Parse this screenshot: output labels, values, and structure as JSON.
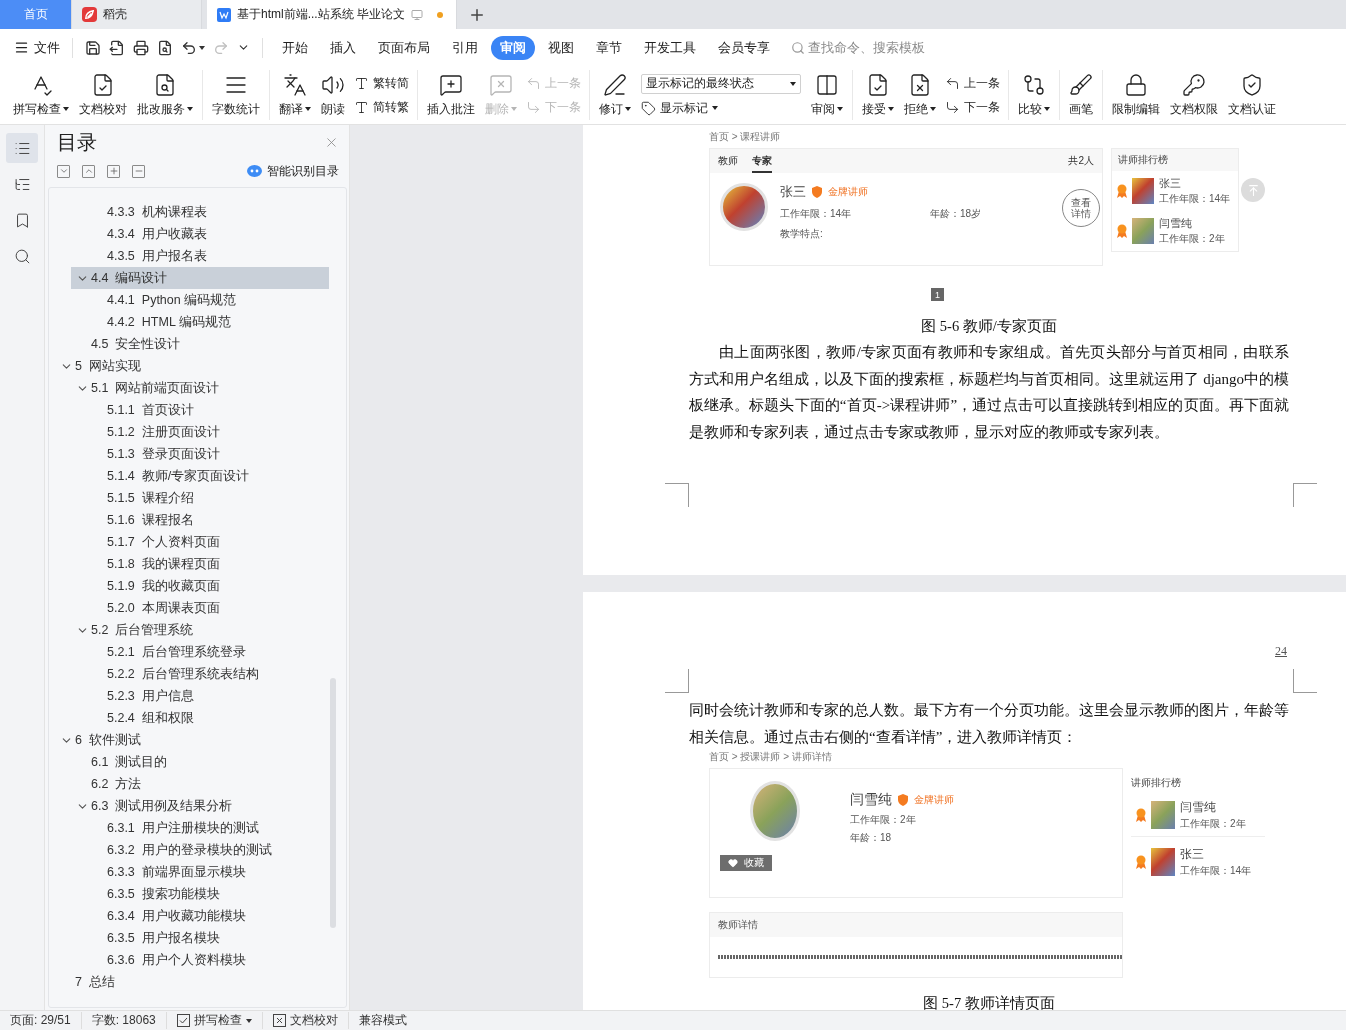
{
  "tabs": [
    {
      "label": "首页",
      "kind": "home",
      "selected": false
    },
    {
      "label": "稻壳",
      "kind": "app",
      "selected": false
    },
    {
      "label": "基于html前端...站系统 毕业论文",
      "kind": "document",
      "selected": true,
      "unsaved": true
    }
  ],
  "menu": {
    "file": "文件",
    "quick_tools": [
      {
        "disabled": false
      },
      {
        "disabled": false
      },
      {
        "disabled": false
      },
      {
        "disabled": false
      },
      {
        "disabled": false
      },
      {
        "disabled": true
      },
      {
        "disabled": false
      }
    ],
    "tabs": [
      {
        "label": "开始",
        "selected": false
      },
      {
        "label": "插入",
        "selected": false
      },
      {
        "label": "页面布局",
        "selected": false
      },
      {
        "label": "引用",
        "selected": false
      },
      {
        "label": "审阅",
        "selected": true
      },
      {
        "label": "视图",
        "selected": false
      },
      {
        "label": "章节",
        "selected": false
      },
      {
        "label": "开发工具",
        "selected": false
      },
      {
        "label": "会员专享",
        "selected": false
      }
    ],
    "search": {
      "placeholder": "查找命令、搜索模板"
    }
  },
  "ribbon": {
    "groups": [
      {
        "items": [
          {
            "kind": "large",
            "label": "拼写检查",
            "dropdown": true,
            "disabled": false
          },
          {
            "kind": "large",
            "label": "文档校对",
            "dropdown": false,
            "disabled": false
          },
          {
            "kind": "large",
            "label": "批改服务",
            "dropdown": true,
            "disabled": false
          }
        ]
      },
      {
        "items": [
          {
            "kind": "large",
            "label": "字数统计",
            "dropdown": false,
            "disabled": false
          }
        ]
      },
      {
        "items": [
          {
            "kind": "large",
            "label": "翻译",
            "dropdown": true,
            "disabled": false
          },
          {
            "kind": "large",
            "label": "朗读",
            "dropdown": false,
            "disabled": false
          },
          {
            "kind": "stack",
            "rows": [
              {
                "label": "繁转简",
                "disabled": false
              },
              {
                "label": "简转繁",
                "disabled": false
              }
            ]
          }
        ]
      },
      {
        "items": [
          {
            "kind": "large",
            "label": "插入批注",
            "dropdown": false,
            "disabled": false
          },
          {
            "kind": "large",
            "label": "删除",
            "dropdown": true,
            "disabled": true
          },
          {
            "kind": "stack",
            "rows": [
              {
                "label": "上一条",
                "disabled": true
              },
              {
                "label": "下一条",
                "disabled": true
              }
            ]
          }
        ]
      },
      {
        "items": [
          {
            "kind": "large",
            "label": "修订",
            "dropdown": true,
            "disabled": false
          },
          {
            "kind": "select",
            "value": "显示标记的最终状态",
            "option": {
              "label": "显示标记",
              "dropdown": true
            }
          },
          {
            "kind": "large",
            "label": "审阅",
            "dropdown": true,
            "disabled": false
          }
        ]
      },
      {
        "items": [
          {
            "kind": "large",
            "label": "接受",
            "dropdown": true,
            "disabled": false
          },
          {
            "kind": "large",
            "label": "拒绝",
            "dropdown": true,
            "disabled": false
          },
          {
            "kind": "stack",
            "rows": [
              {
                "label": "上一条",
                "disabled": false
              },
              {
                "label": "下一条",
                "disabled": false
              }
            ]
          }
        ]
      },
      {
        "items": [
          {
            "kind": "large",
            "label": "比较",
            "dropdown": true,
            "disabled": false
          }
        ]
      },
      {
        "items": [
          {
            "kind": "large",
            "label": "画笔",
            "dropdown": false,
            "disabled": false
          }
        ]
      },
      {
        "items": [
          {
            "kind": "large",
            "label": "限制编辑",
            "dropdown": false,
            "disabled": false
          },
          {
            "kind": "large",
            "label": "文档权限",
            "dropdown": false,
            "disabled": false
          },
          {
            "kind": "large",
            "label": "文档认证",
            "dropdown": false,
            "disabled": false
          }
        ]
      }
    ]
  },
  "rail": [
    {
      "selected": true
    },
    {
      "selected": false
    },
    {
      "selected": false
    },
    {
      "selected": false
    }
  ],
  "toc": {
    "title": "目录",
    "smart_button": "智能识别目录",
    "tree": [
      {
        "children": [
          {
            "children": [
              {
                "number": "4.3.3",
                "title": "机构课程表",
                "selected": false
              },
              {
                "number": "4.3.4",
                "title": "用户收藏表",
                "selected": false
              },
              {
                "number": "4.3.5",
                "title": "用户报名表",
                "selected": false
              }
            ]
          },
          {
            "number": "4.4",
            "title": "编码设计",
            "selected": true,
            "expanded": true,
            "children": [
              {
                "number": "4.4.1",
                "title": "Python 编码规范",
                "selected": false
              },
              {
                "number": "4.4.2",
                "title": "HTML 编码规范",
                "selected": false
              }
            ]
          },
          {
            "number": "4.5",
            "title": "安全性设计",
            "selected": false
          }
        ]
      },
      {
        "number": "5",
        "title": "网站实现",
        "selected": false,
        "expanded": true,
        "children": [
          {
            "number": "5.1",
            "title": "网站前端页面设计",
            "selected": false,
            "expanded": true,
            "children": [
              {
                "number": "5.1.1",
                "title": "首页设计",
                "selected": false
              },
              {
                "number": "5.1.2",
                "title": "注册页面设计",
                "selected": false
              },
              {
                "number": "5.1.3",
                "title": "登录页面设计",
                "selected": false
              },
              {
                "number": "5.1.4",
                "title": "教师/专家页面设计",
                "selected": false
              },
              {
                "number": "5.1.5",
                "title": "课程介绍",
                "selected": false
              },
              {
                "number": "5.1.6",
                "title": "课程报名",
                "selected": false
              },
              {
                "number": "5.1.7",
                "title": "个人资料页面",
                "selected": false
              },
              {
                "number": "5.1.8",
                "title": "我的课程页面",
                "selected": false
              },
              {
                "number": "5.1.9",
                "title": "我的收藏页面",
                "selected": false
              },
              {
                "number": "5.2.0",
                "title": "本周课表页面",
                "selected": false
              }
            ]
          },
          {
            "number": "5.2",
            "title": "后台管理系统",
            "selected": false,
            "expanded": true,
            "children": [
              {
                "number": "5.2.1",
                "title": "后台管理系统登录",
                "selected": false
              },
              {
                "number": "5.2.2",
                "title": "后台管理系统表结构",
                "selected": false
              },
              {
                "number": "5.2.3",
                "title": "用户信息",
                "selected": false
              },
              {
                "number": "5.2.4",
                "title": "组和权限",
                "selected": false
              }
            ]
          }
        ]
      },
      {
        "number": "6",
        "title": "软件测试",
        "selected": false,
        "expanded": true,
        "children": [
          {
            "number": "6.1",
            "title": "测试目的",
            "selected": false
          },
          {
            "number": "6.2",
            "title": "方法",
            "selected": false
          },
          {
            "number": "6.3",
            "title": "测试用例及结果分析",
            "selected": false,
            "expanded": true,
            "children": [
              {
                "number": "6.3.1",
                "title": "用户注册模块的测试",
                "selected": false
              },
              {
                "number": "6.3.2",
                "title": "用户的登录模块的测试",
                "selected": false
              },
              {
                "number": "6.3.3",
                "title": "前端界面显示模块",
                "selected": false
              },
              {
                "number": "6.3.5",
                "title": "搜索功能模块",
                "selected": false
              },
              {
                "number": "6.3.4",
                "title": "用户收藏功能模块",
                "selected": false
              },
              {
                "number": "6.3.5",
                "title": "用户报名模块",
                "selected": false
              },
              {
                "number": "6.3.6",
                "title": "用户个人资料模块",
                "selected": false
              }
            ]
          }
        ]
      },
      {
        "number": "7",
        "title": "总结",
        "selected": false
      }
    ]
  },
  "document": {
    "pages": [
      {
        "blocks": [
          {
            "kind": "teacher_list",
            "breadcrumb": "首页 > 课程讲师",
            "tabs": [
              {
                "label": "教师",
                "selected": false
              },
              {
                "label": "专家",
                "selected": true
              }
            ],
            "count": "共2人",
            "teacher": {
              "name": "张三",
              "badge": "金牌讲师",
              "years": "工作年限：14年",
              "age": "年龄：18岁",
              "feature": "教学特点:",
              "action": "查看详情"
            },
            "ranking": {
              "title": "讲师排行榜",
              "rows": [
                {
                  "name": "张三",
                  "years": "工作年限：14年"
                },
                {
                  "name": "闫雪纯",
                  "years": "工作年限：2年"
                }
              ]
            }
          },
          {
            "kind": "pager",
            "pages": [
              {
                "label": "1",
                "selected": true
              }
            ]
          },
          {
            "kind": "caption",
            "text": "图 5-6 教师/专家页面"
          },
          {
            "kind": "paragraph",
            "indent": true,
            "text": "由上面两张图，教师/专家页面有教师和专家组成。首先页头部分与首页相同，由联系方式和用户名组成，以及下面的搜索框，标题栏均与首页相同。这里就运用了 django中的模板继承。标题头下面的“首页->课程讲师”，通过点击可以直接跳转到相应的页面。再下面就是教师和专家列表，通过点击专家或教师，显示对应的教师或专家列表。"
          }
        ]
      },
      {
        "page_number": "24",
        "blocks": [
          {
            "kind": "paragraph",
            "indent": false,
            "text": "同时会统计教师和专家的总人数。最下方有一个分页功能。这里会显示教师的图片，年龄等相关信息。通过点击右侧的“查看详情”，进入教师详情页："
          },
          {
            "kind": "teacher_detail",
            "breadcrumb": "首页 > 授课讲师 > 讲师详情",
            "teacher": {
              "name": "闫雪纯",
              "badge": "金牌讲师",
              "years": "工作年限：2年",
              "age": "年龄：18",
              "favorite": "收藏"
            },
            "ranking": {
              "title": "讲师排行榜",
              "rows": [
                {
                  "name": "闫雪纯",
                  "years": "工作年限：2年"
                },
                {
                  "name": "张三",
                  "years": "工作年限：14年"
                }
              ]
            },
            "detail_title": "教师详情"
          },
          {
            "kind": "caption",
            "text": "图 5-7 教师详情页面"
          }
        ]
      }
    ]
  },
  "status_bar": [
    {
      "kind": "text",
      "label": "页面: 29/51"
    },
    {
      "kind": "text",
      "label": "字数: 18063"
    },
    {
      "kind": "check",
      "label": "拼写检查",
      "dropdown": true
    },
    {
      "kind": "proof",
      "label": "文档校对"
    },
    {
      "kind": "text",
      "label": "兼容模式"
    }
  ]
}
